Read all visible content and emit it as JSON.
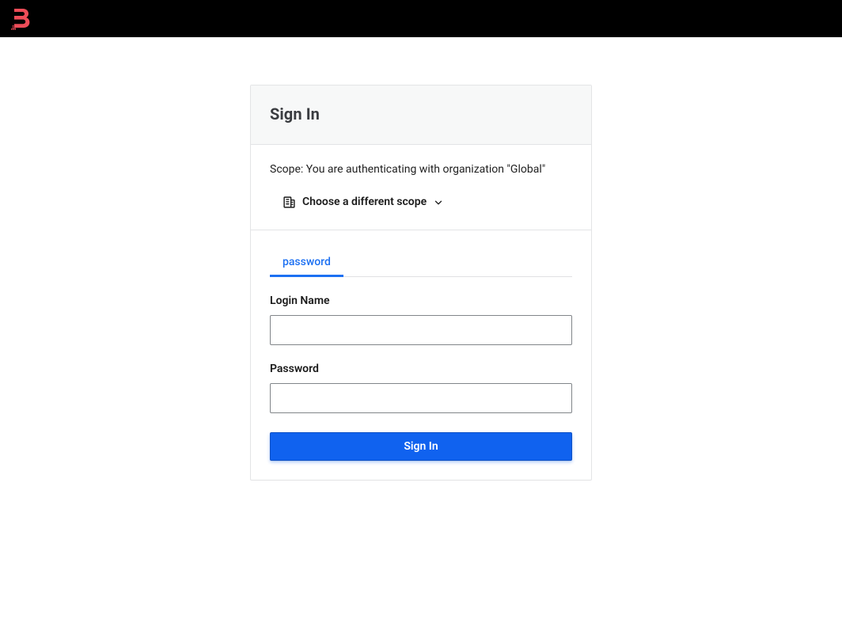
{
  "header": {
    "logo_color": "#ed4c58"
  },
  "card": {
    "title": "Sign In",
    "scope_prefix": "Scope: You are authenticating with organization \"",
    "scope_org": "Global",
    "scope_suffix": "\"",
    "choose_scope_label": "Choose a different scope"
  },
  "tabs": {
    "active": "password"
  },
  "form": {
    "login_label": "Login Name",
    "login_value": "",
    "password_label": "Password",
    "password_value": "",
    "submit_label": "Sign In"
  }
}
